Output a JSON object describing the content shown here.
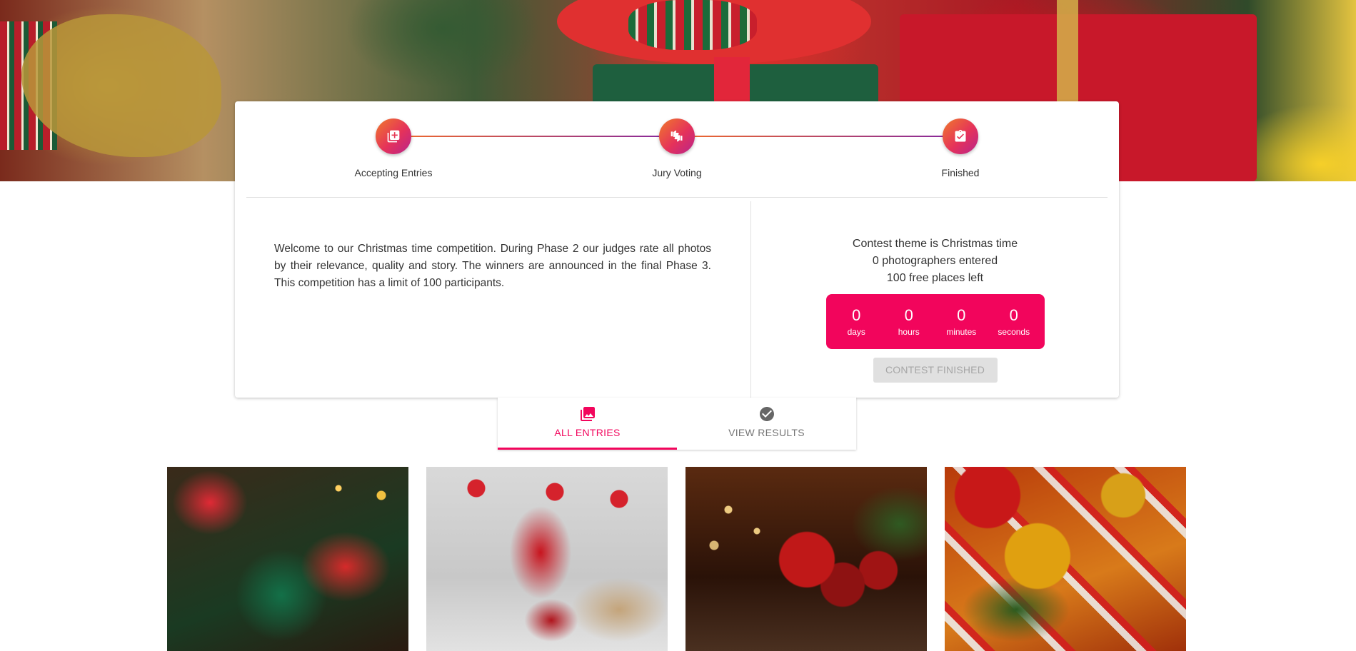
{
  "stepper": {
    "steps": [
      {
        "label": "Accepting Entries",
        "icon": "add-photo-icon"
      },
      {
        "label": "Jury Voting",
        "icon": "thumbs-vote-icon"
      },
      {
        "label": "Finished",
        "icon": "clipboard-check-icon"
      }
    ]
  },
  "description": "Welcome to our Christmas time competition. During Phase 2 our judges rate all photos by their relevance, quality and story. The winners are announced in the final Phase 3. This competition has a limit of 100 participants.",
  "info": {
    "theme": "Contest theme is Christmas time",
    "entered": "0 photographers entered",
    "places": "100 free places left"
  },
  "countdown": {
    "days": {
      "value": "0",
      "label": "days"
    },
    "hours": {
      "value": "0",
      "label": "hours"
    },
    "minutes": {
      "value": "0",
      "label": "minutes"
    },
    "seconds": {
      "value": "0",
      "label": "seconds"
    }
  },
  "button": {
    "label": "CONTEST FINISHED"
  },
  "tabs": [
    {
      "label": "ALL ENTRIES",
      "icon": "photo-library-icon",
      "active": true
    },
    {
      "label": "VIEW RESULTS",
      "icon": "check-circle-icon",
      "active": false
    }
  ],
  "colors": {
    "accent": "#f2055c",
    "gradient_start": "#f07a2a",
    "gradient_end": "#b8248c",
    "disabled_bg": "#e0e0e0",
    "disabled_text": "#a6a6a6"
  }
}
